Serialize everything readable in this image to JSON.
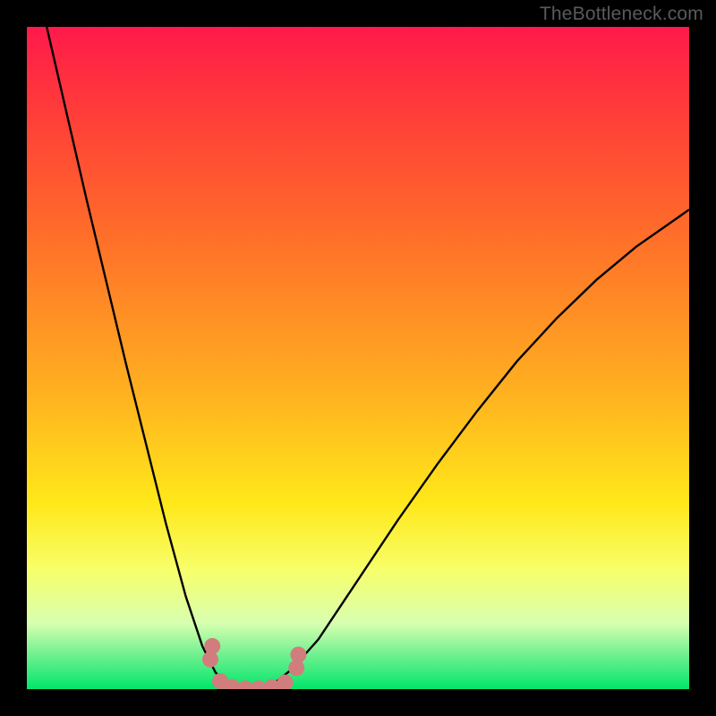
{
  "watermark": {
    "text": "TheBottleneck.com"
  },
  "chart_data": {
    "type": "line",
    "title": "",
    "xlabel": "",
    "ylabel": "",
    "xlim": [
      0,
      1
    ],
    "ylim": [
      0,
      1
    ],
    "series": [
      {
        "name": "curve",
        "x": [
          0.03,
          0.06,
          0.09,
          0.12,
          0.15,
          0.18,
          0.21,
          0.24,
          0.265,
          0.285,
          0.3,
          0.32,
          0.345,
          0.375,
          0.4,
          0.44,
          0.5,
          0.56,
          0.62,
          0.68,
          0.74,
          0.8,
          0.86,
          0.92,
          0.98,
          1.0
        ],
        "y": [
          1.0,
          0.87,
          0.74,
          0.615,
          0.49,
          0.37,
          0.25,
          0.14,
          0.065,
          0.025,
          0.01,
          0.003,
          0.003,
          0.01,
          0.03,
          0.075,
          0.165,
          0.255,
          0.34,
          0.42,
          0.495,
          0.56,
          0.618,
          0.668,
          0.71,
          0.724
        ]
      }
    ],
    "markers": [
      {
        "x": 0.277,
        "y": 0.045
      },
      {
        "x": 0.28,
        "y": 0.065
      },
      {
        "x": 0.292,
        "y": 0.012
      },
      {
        "x": 0.31,
        "y": 0.003
      },
      {
        "x": 0.33,
        "y": 0.001
      },
      {
        "x": 0.35,
        "y": 0.001
      },
      {
        "x": 0.37,
        "y": 0.003
      },
      {
        "x": 0.39,
        "y": 0.01
      },
      {
        "x": 0.407,
        "y": 0.032
      },
      {
        "x": 0.41,
        "y": 0.052
      }
    ],
    "background_gradient": {
      "top": "#ff1a4b",
      "mid": "#ffe81a",
      "bottom": "#00e66a"
    },
    "curve_color": "#000000",
    "marker_color": "#d27d7d"
  }
}
